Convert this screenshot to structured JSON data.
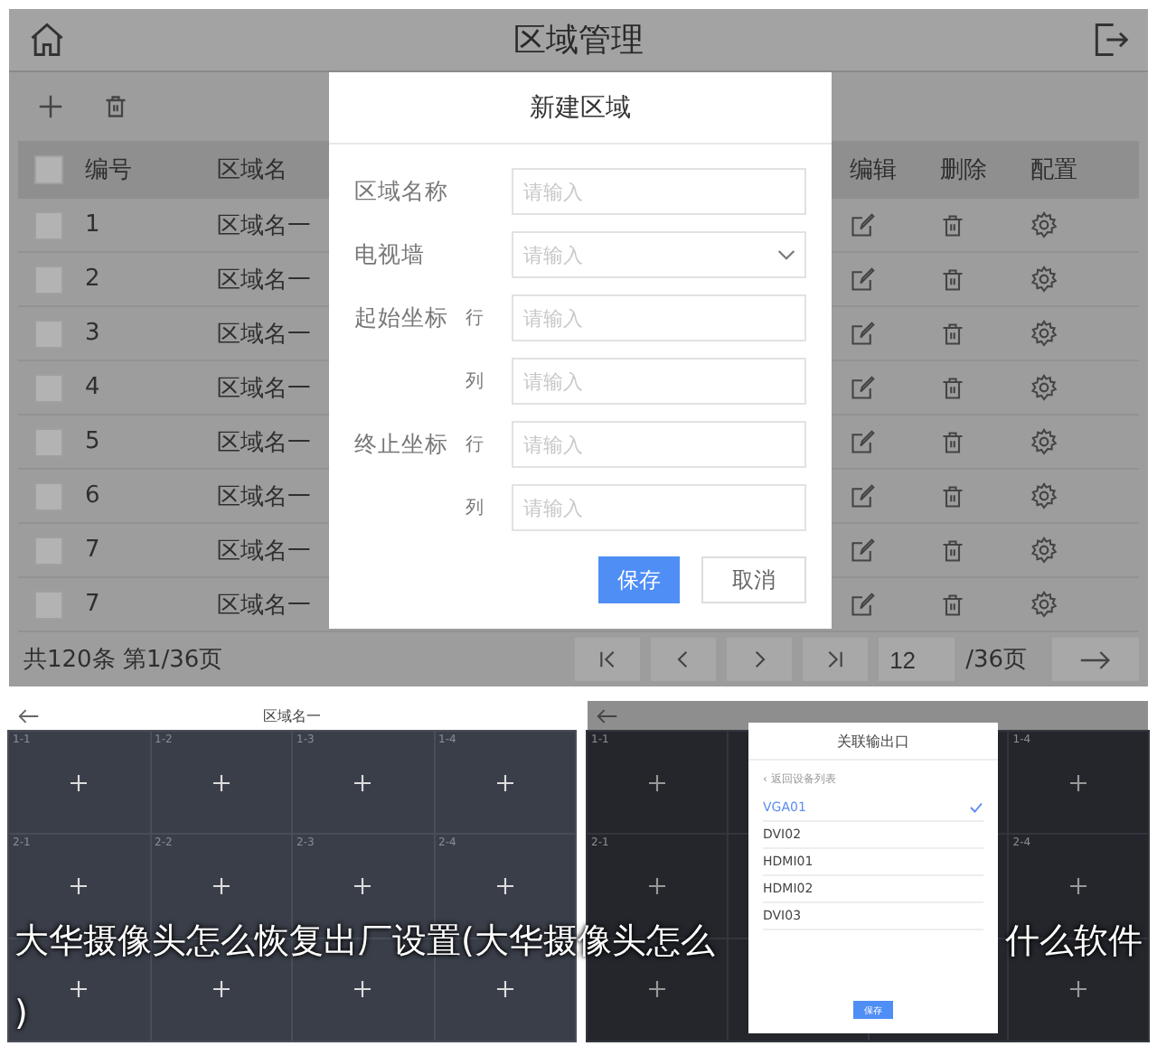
{
  "app": {
    "title": "区域管理"
  },
  "table": {
    "all_checked": false,
    "columns": [
      "编号",
      "区域名",
      "编辑",
      "删除",
      "配置"
    ],
    "rows": [
      {
        "number": "1",
        "name": "区域名一",
        "checked": false
      },
      {
        "number": "2",
        "name": "区域名一",
        "checked": false
      },
      {
        "number": "3",
        "name": "区域名一",
        "checked": false
      },
      {
        "number": "4",
        "name": "区域名一",
        "checked": false
      },
      {
        "number": "5",
        "name": "区域名一",
        "checked": false
      },
      {
        "number": "6",
        "name": "区域名一",
        "checked": false
      },
      {
        "number": "7",
        "name": "区域名一",
        "checked": false
      },
      {
        "number": "7",
        "name": "区域名一",
        "checked": false
      }
    ]
  },
  "footer": {
    "summary": "共120条 第1/36页",
    "page_input": "12",
    "page_total": "/36页"
  },
  "dialog": {
    "title": "新建区域",
    "fields": [
      {
        "label": "区域名称",
        "kind": "text",
        "placeholder": "请输入"
      },
      {
        "label": "电视墙",
        "kind": "select",
        "placeholder": "请输入"
      },
      {
        "label": "起始坐标",
        "sublabel": "行",
        "kind": "text",
        "placeholder": "请输入"
      },
      {
        "sublabel": "列",
        "kind": "text",
        "placeholder": "请输入"
      },
      {
        "label": "终止坐标",
        "sublabel": "行",
        "kind": "text",
        "placeholder": "请输入"
      },
      {
        "sublabel": "列",
        "kind": "text",
        "placeholder": "请输入"
      }
    ],
    "buttons": [
      {
        "label": "保存",
        "kind": "primary"
      },
      {
        "label": "取消",
        "kind": "secondary"
      }
    ]
  },
  "wall_view": {
    "title": "区域名一",
    "cell_labels": [
      "1-1",
      "1-2",
      "1-3",
      "1-4",
      "2-1",
      "2-2",
      "2-3",
      "2-4"
    ]
  },
  "output_view": {
    "cell_labels": [
      "1-1",
      "1-4",
      "2-1",
      "2-4"
    ],
    "dialog": {
      "title": "关联输出口",
      "back": "‹ 返回设备列表",
      "button": "保存",
      "outputs": [
        {
          "name": "VGA01",
          "selected": true
        },
        {
          "name": "DVI02",
          "selected": false
        },
        {
          "name": "HDMI01",
          "selected": false
        },
        {
          "name": "HDMI02",
          "selected": false
        },
        {
          "name": "DVI03",
          "selected": false
        }
      ]
    }
  },
  "caption": {
    "parts": [
      "大华摄像头怎么恢复出厂设置(大华摄像头怎么",
      "什么软件",
      ")"
    ]
  }
}
